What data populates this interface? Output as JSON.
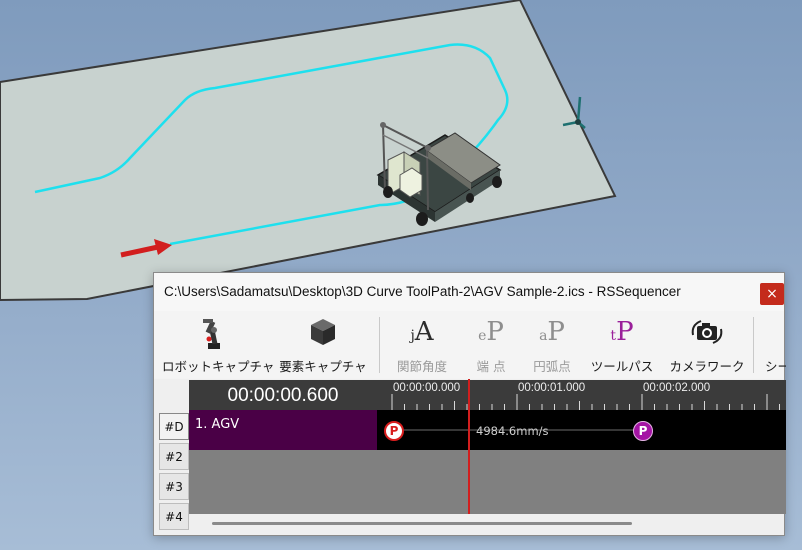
{
  "window": {
    "title": "C:\\Users\\Sadamatsu\\Desktop\\3D Curve ToolPath-2\\AGV Sample-2.ics - RSSequencer",
    "close_label": "×"
  },
  "toolbar": {
    "robot_capture": "ロボットキャプチャ",
    "element_capture": "要素キャプチャ",
    "joint_angle": "関節角度",
    "end_point": "端 点",
    "arc_point": "円弧点",
    "tool_path": "ツールパス",
    "camera_work": "カメラワーク",
    "scene": "シー",
    "joint_glyph_sub": "j",
    "joint_glyph_main": "A",
    "end_glyph_sub": "e",
    "end_glyph_main": "P",
    "arc_glyph_sub": "a",
    "arc_glyph_main": "P",
    "tool_glyph_sub": "t",
    "tool_glyph_main": "P"
  },
  "timeline": {
    "current_time": "00:00:00.600",
    "ticks": [
      "00:00:00.000",
      "00:00:01.000",
      "00:00:02.000"
    ],
    "rows": [
      "#D",
      "#2",
      "#3",
      "#4"
    ],
    "track_label": "1.  AGV",
    "speed_label": "4984.6mm/s",
    "start_pin": "P",
    "end_pin": "P"
  },
  "colors": {
    "path": "#1ee0ee",
    "track_name_bg": "#4a0046",
    "cursor": "#d21e1e",
    "pin_purple": "#a414a4"
  }
}
